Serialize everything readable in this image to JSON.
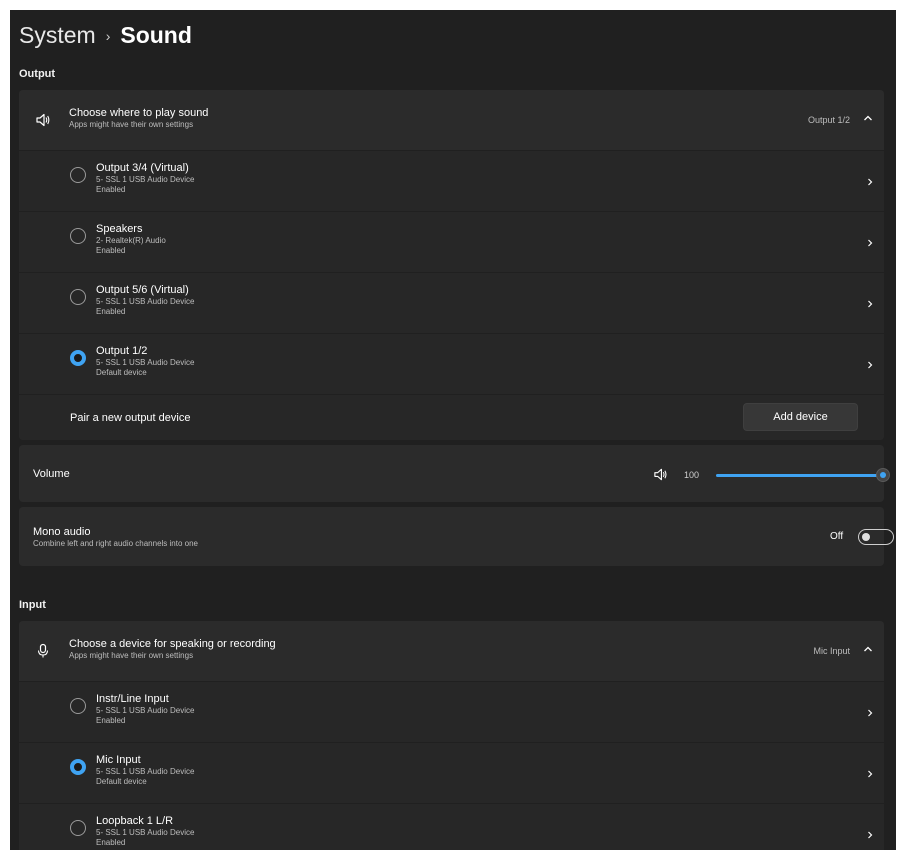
{
  "header": {
    "root": "System",
    "separator": "›",
    "page": "Sound"
  },
  "output": {
    "section_label": "Output",
    "chooser": {
      "title": "Choose where to play sound",
      "subtitle": "Apps might have their own settings",
      "selected": "Output 1/2",
      "icon": "speaker-icon"
    },
    "devices": [
      {
        "name": "Output 3/4 (Virtual)",
        "detail": "5- SSL 1 USB Audio Device",
        "status": "Enabled",
        "selected": false
      },
      {
        "name": "Speakers",
        "detail": "2- Realtek(R) Audio",
        "status": "Enabled",
        "selected": false
      },
      {
        "name": "Output 5/6 (Virtual)",
        "detail": "5- SSL 1 USB Audio Device",
        "status": "Enabled",
        "selected": false
      },
      {
        "name": "Output 1/2",
        "detail": "5- SSL 1 USB Audio Device",
        "status": "Default device",
        "selected": true
      }
    ],
    "pair": {
      "label": "Pair a new output device",
      "button": "Add device"
    },
    "volume": {
      "label": "Volume",
      "value": "100",
      "level_percent": 100
    },
    "mono": {
      "title": "Mono audio",
      "subtitle": "Combine left and right audio channels into one",
      "state": "Off"
    }
  },
  "input": {
    "section_label": "Input",
    "chooser": {
      "title": "Choose a device for speaking or recording",
      "subtitle": "Apps might have their own settings",
      "selected": "Mic Input",
      "icon": "microphone-icon"
    },
    "devices": [
      {
        "name": "Instr/Line Input",
        "detail": "5- SSL 1 USB Audio Device",
        "status": "Enabled",
        "selected": false
      },
      {
        "name": "Mic Input",
        "detail": "5- SSL 1 USB Audio Device",
        "status": "Default device",
        "selected": true
      },
      {
        "name": "Loopback 1 L/R",
        "detail": "5- SSL 1 USB Audio Device",
        "status": "Enabled",
        "selected": false
      }
    ]
  },
  "colors": {
    "accent": "#3fa3f2",
    "background": "#202020",
    "card": "#2b2b2b"
  }
}
